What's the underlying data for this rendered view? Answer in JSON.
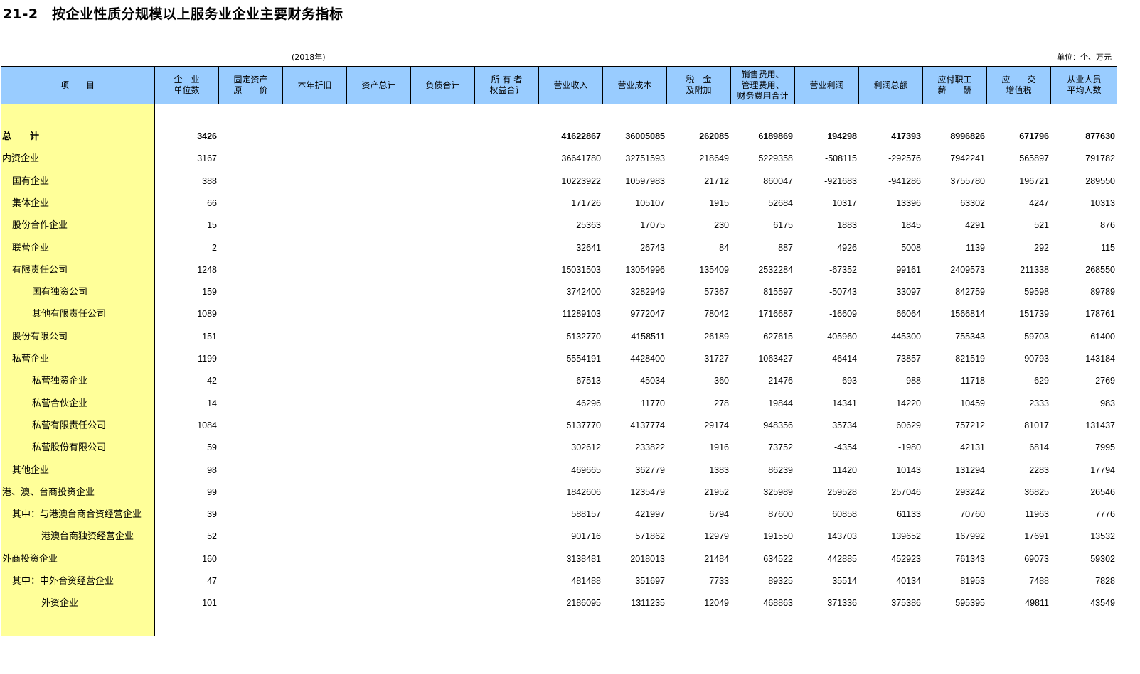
{
  "title": "21-2　按企业性质分规模以上服务业企业主要财务指标",
  "year": "(2018年)",
  "unit": "单位：个、万元",
  "headers": [
    "项　　目",
    "企　业\n单位数",
    "固定资产\n原　　价",
    "本年折旧",
    "资产总计",
    "负债合计",
    "所 有 者\n权益合计",
    "营业收入",
    "营业成本",
    "税　金\n及附加",
    "销售费用、\n管理费用、\n财务费用合计",
    "营业利润",
    "利润总额",
    "应付职工\n薪　　酬",
    "应　　交\n增值税",
    "从业人员\n平均人数"
  ],
  "rows": [
    {
      "label": "总　　计",
      "indent": 0,
      "bold": true,
      "values": [
        "3426",
        "",
        "",
        "",
        "",
        "",
        "41622867",
        "36005085",
        "262085",
        "6189869",
        "194298",
        "417393",
        "8996826",
        "671796",
        "877630"
      ]
    },
    {
      "label": "内资企业",
      "indent": 0,
      "values": [
        "3167",
        "",
        "",
        "",
        "",
        "",
        "36641780",
        "32751593",
        "218649",
        "5229358",
        "-508115",
        "-292576",
        "7942241",
        "565897",
        "791782"
      ]
    },
    {
      "label": "国有企业",
      "indent": 1,
      "values": [
        "388",
        "",
        "",
        "",
        "",
        "",
        "10223922",
        "10597983",
        "21712",
        "860047",
        "-921683",
        "-941286",
        "3755780",
        "196721",
        "289550"
      ]
    },
    {
      "label": "集体企业",
      "indent": 1,
      "values": [
        "66",
        "",
        "",
        "",
        "",
        "",
        "171726",
        "105107",
        "1915",
        "52684",
        "10317",
        "13396",
        "63302",
        "4247",
        "10313"
      ]
    },
    {
      "label": "股份合作企业",
      "indent": 1,
      "values": [
        "15",
        "",
        "",
        "",
        "",
        "",
        "25363",
        "17075",
        "230",
        "6175",
        "1883",
        "1845",
        "4291",
        "521",
        "876"
      ]
    },
    {
      "label": "联营企业",
      "indent": 1,
      "values": [
        "2",
        "",
        "",
        "",
        "",
        "",
        "32641",
        "26743",
        "84",
        "887",
        "4926",
        "5008",
        "1139",
        "292",
        "115"
      ]
    },
    {
      "label": "有限责任公司",
      "indent": 1,
      "values": [
        "1248",
        "",
        "",
        "",
        "",
        "",
        "15031503",
        "13054996",
        "135409",
        "2532284",
        "-67352",
        "99161",
        "2409573",
        "211338",
        "268550"
      ]
    },
    {
      "label": "国有独资公司",
      "indent": 2,
      "values": [
        "159",
        "",
        "",
        "",
        "",
        "",
        "3742400",
        "3282949",
        "57367",
        "815597",
        "-50743",
        "33097",
        "842759",
        "59598",
        "89789"
      ]
    },
    {
      "label": "其他有限责任公司",
      "indent": 2,
      "values": [
        "1089",
        "",
        "",
        "",
        "",
        "",
        "11289103",
        "9772047",
        "78042",
        "1716687",
        "-16609",
        "66064",
        "1566814",
        "151739",
        "178761"
      ]
    },
    {
      "label": "股份有限公司",
      "indent": 1,
      "values": [
        "151",
        "",
        "",
        "",
        "",
        "",
        "5132770",
        "4158511",
        "26189",
        "627615",
        "405960",
        "445300",
        "755343",
        "59703",
        "61400"
      ]
    },
    {
      "label": "私营企业",
      "indent": 1,
      "values": [
        "1199",
        "",
        "",
        "",
        "",
        "",
        "5554191",
        "4428400",
        "31727",
        "1063427",
        "46414",
        "73857",
        "821519",
        "90793",
        "143184"
      ]
    },
    {
      "label": "私营独资企业",
      "indent": 2,
      "values": [
        "42",
        "",
        "",
        "",
        "",
        "",
        "67513",
        "45034",
        "360",
        "21476",
        "693",
        "988",
        "11718",
        "629",
        "2769"
      ]
    },
    {
      "label": "私营合伙企业",
      "indent": 2,
      "values": [
        "14",
        "",
        "",
        "",
        "",
        "",
        "46296",
        "11770",
        "278",
        "19844",
        "14341",
        "14220",
        "10459",
        "2333",
        "983"
      ]
    },
    {
      "label": "私营有限责任公司",
      "indent": 2,
      "values": [
        "1084",
        "",
        "",
        "",
        "",
        "",
        "5137770",
        "4137774",
        "29174",
        "948356",
        "35734",
        "60629",
        "757212",
        "81017",
        "131437"
      ]
    },
    {
      "label": "私营股份有限公司",
      "indent": 2,
      "values": [
        "59",
        "",
        "",
        "",
        "",
        "",
        "302612",
        "233822",
        "1916",
        "73752",
        "-4354",
        "-1980",
        "42131",
        "6814",
        "7995"
      ]
    },
    {
      "label": "其他企业",
      "indent": 1,
      "values": [
        "98",
        "",
        "",
        "",
        "",
        "",
        "469665",
        "362779",
        "1383",
        "86239",
        "11420",
        "10143",
        "131294",
        "2283",
        "17794"
      ]
    },
    {
      "label": "港、澳、台商投资企业",
      "indent": 0,
      "values": [
        "99",
        "",
        "",
        "",
        "",
        "",
        "1842606",
        "1235479",
        "21952",
        "325989",
        "259528",
        "257046",
        "293242",
        "36825",
        "26546"
      ]
    },
    {
      "label": "其中：与港澳台商合资经营企业",
      "indent": 1,
      "values": [
        "39",
        "",
        "",
        "",
        "",
        "",
        "588157",
        "421997",
        "6794",
        "87600",
        "60858",
        "61133",
        "70760",
        "11963",
        "7776"
      ]
    },
    {
      "label": "港澳台商独资经营企业",
      "indent": 3,
      "values": [
        "52",
        "",
        "",
        "",
        "",
        "",
        "901716",
        "571862",
        "12979",
        "191550",
        "143703",
        "139652",
        "167992",
        "17691",
        "13532"
      ]
    },
    {
      "label": "外商投资企业",
      "indent": 0,
      "values": [
        "160",
        "",
        "",
        "",
        "",
        "",
        "3138481",
        "2018013",
        "21484",
        "634522",
        "442885",
        "452923",
        "761343",
        "69073",
        "59302"
      ]
    },
    {
      "label": "其中：中外合资经营企业",
      "indent": 1,
      "values": [
        "47",
        "",
        "",
        "",
        "",
        "",
        "481488",
        "351697",
        "7733",
        "89325",
        "35514",
        "40134",
        "81953",
        "7488",
        "7828"
      ]
    },
    {
      "label": "外资企业",
      "indent": 3,
      "values": [
        "101",
        "",
        "",
        "",
        "",
        "",
        "2186095",
        "1311235",
        "12049",
        "468863",
        "371336",
        "375386",
        "595395",
        "49811",
        "43549"
      ]
    }
  ]
}
